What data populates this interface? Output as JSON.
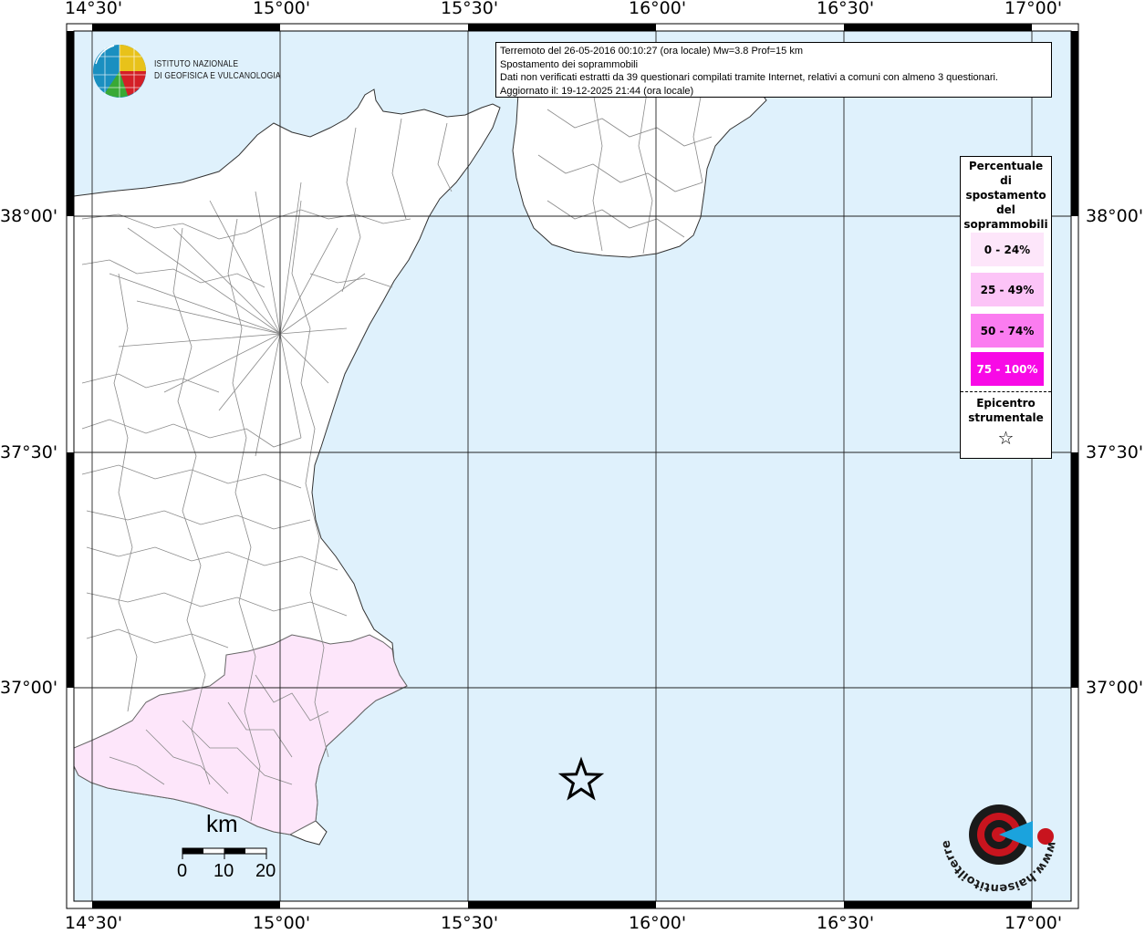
{
  "map": {
    "lon_labels": [
      "14°30'",
      "15°00'",
      "15°30'",
      "16°00'",
      "16°30'",
      "17°00'"
    ],
    "lat_labels": [
      "38°00'",
      "37°30'",
      "37°00'"
    ],
    "land_color": "#ffffff",
    "sea_color": "#dff1fc",
    "felt_color": "#fde6fa",
    "border_color": "#7a7a7a",
    "epicenter_symbol": "star"
  },
  "info": {
    "line1": "Terremoto del 26-05-2016 00:10:27 (ora locale) Mw=3.8 Prof=15 km",
    "line2": "Spostamento dei soprammobili",
    "line3": "Dati non verificati estratti da 39 questionari compilati tramite Internet, relativi a comuni con almeno 3 questionari.",
    "line4": "Aggiornato il: 19-12-2025 21:44 (ora locale)"
  },
  "legend": {
    "title": [
      "Percentuale",
      "di",
      "spostamento",
      "del",
      "soprammobili"
    ],
    "items": [
      {
        "label": "0 - 24%",
        "color": "#fde6fa",
        "text_color": "#000000"
      },
      {
        "label": "25 - 49%",
        "color": "#fcc4f7",
        "text_color": "#000000"
      },
      {
        "label": "50 - 74%",
        "color": "#fb7cf0",
        "text_color": "#000000"
      },
      {
        "label": "75 - 100%",
        "color": "#f809e6",
        "text_color": "#ffffff"
      }
    ],
    "epicenter_label": [
      "Epicentro",
      "strumentale"
    ],
    "epicenter_icon": "star-outline-icon"
  },
  "scale_bar": {
    "unit": "km",
    "ticks": [
      "0",
      "10",
      "20"
    ]
  },
  "logos": {
    "ingv_line1": "ISTITUTO NAZIONALE",
    "ingv_line2": "DI GEOFISICA E VULCANOLOGIA",
    "hst_text": "www.haisentitoilterremoto.it"
  }
}
